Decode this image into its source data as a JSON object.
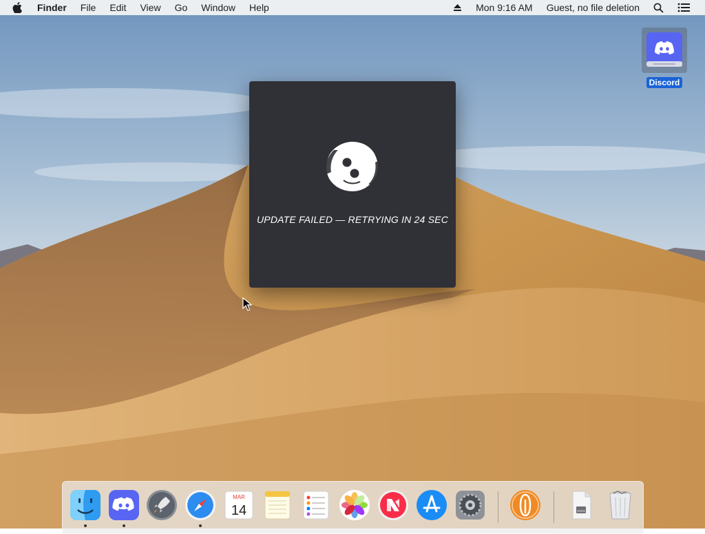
{
  "menubar": {
    "app_name": "Finder",
    "menus": [
      "File",
      "Edit",
      "View",
      "Go",
      "Window",
      "Help"
    ],
    "clock": "Mon 9:16 AM",
    "user": "Guest, no file deletion"
  },
  "desktop": {
    "icons": [
      {
        "label": "Discord",
        "icon": "discord-drive-icon"
      }
    ]
  },
  "dialog": {
    "status_text": "UPDATE FAILED — RETRYING IN 24 SEC",
    "logo": "discord-updater-logo"
  },
  "dock": {
    "items": [
      {
        "name": "Finder",
        "icon": "finder-icon",
        "running": true
      },
      {
        "name": "Discord",
        "icon": "discord-icon",
        "running": true
      },
      {
        "name": "Launchpad",
        "icon": "launchpad-icon",
        "running": false
      },
      {
        "name": "Safari",
        "icon": "safari-icon",
        "running": true
      },
      {
        "name": "Calendar",
        "icon": "calendar-icon",
        "running": false,
        "month": "MAR",
        "day": "14"
      },
      {
        "name": "Notes",
        "icon": "notes-icon",
        "running": false
      },
      {
        "name": "Reminders",
        "icon": "reminders-icon",
        "running": false
      },
      {
        "name": "Photos",
        "icon": "photos-icon",
        "running": false
      },
      {
        "name": "News",
        "icon": "news-icon",
        "running": false
      },
      {
        "name": "App Store",
        "icon": "app-store-icon",
        "running": false
      },
      {
        "name": "System Preferences",
        "icon": "system-preferences-icon",
        "running": false
      },
      {
        "name": "Anki",
        "icon": "anki-icon",
        "running": false
      },
      {
        "name": "Downloads",
        "icon": "downloads-stack-icon",
        "running": false
      },
      {
        "name": "Trash",
        "icon": "trash-icon",
        "running": false
      }
    ]
  },
  "colors": {
    "dialog_bg": "#2f3136",
    "discord_blurple": "#5865f2",
    "selection_blue": "#1b63d6"
  }
}
